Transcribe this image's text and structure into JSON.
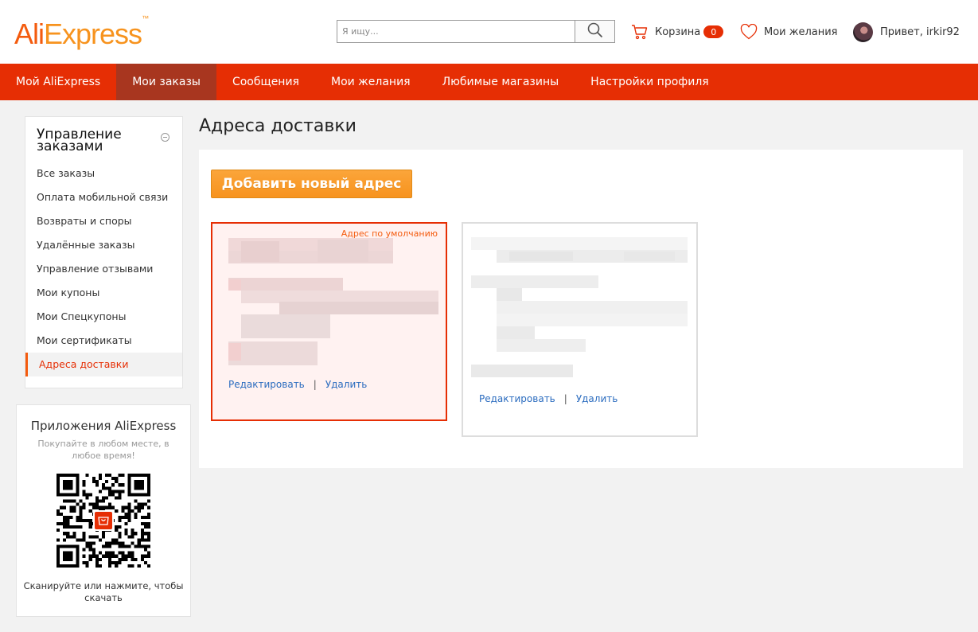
{
  "header": {
    "logo": {
      "ali": "Ali",
      "express": "Express",
      "tm": "™"
    },
    "search": {
      "placeholder": "Я ищу...",
      "value": ""
    },
    "cart": {
      "label": "Корзина",
      "count": "0"
    },
    "wishlist": {
      "label": "Мои желания"
    },
    "user": {
      "greeting": "Привет, irkir92"
    }
  },
  "nav": {
    "items": [
      {
        "label": "Мой AliExpress"
      },
      {
        "label": "Мои заказы",
        "active": true
      },
      {
        "label": "Сообщения"
      },
      {
        "label": "Мои желания"
      },
      {
        "label": "Любимые магазины"
      },
      {
        "label": "Настройки профиля"
      }
    ]
  },
  "sidebar": {
    "title": "Управление заказами",
    "items": [
      {
        "label": "Все заказы"
      },
      {
        "label": "Оплата мобильной связи"
      },
      {
        "label": "Возвраты и споры"
      },
      {
        "label": "Удалённые заказы"
      },
      {
        "label": "Управление отзывами"
      },
      {
        "label": "Мои купоны"
      },
      {
        "label": "Мои Спецкупоны"
      },
      {
        "label": "Мои сертификаты"
      },
      {
        "label": "Адреса доставки",
        "active": true
      }
    ]
  },
  "apps": {
    "title": "Приложения AliExpress",
    "subtitle": "Покупайте в любом месте, в любое время!",
    "scan": "Сканируйте или нажмите, чтобы скачать"
  },
  "main": {
    "title": "Адреса доставки",
    "add_button": "Добавить новый адрес",
    "addresses": [
      {
        "default_label": "Адрес по умолчанию",
        "edit": "Редактировать",
        "separator": "|",
        "delete": "Удалить"
      },
      {
        "edit": "Редактировать",
        "separator": "|",
        "delete": "Удалить"
      }
    ]
  },
  "colors": {
    "accent": "#e62e04",
    "nav_active": "#a8361f",
    "brand_orange": "#f45b0e",
    "button_orange": "#f7931e",
    "link": "#2b6cbf"
  },
  "icons": [
    "search-icon",
    "cart-icon",
    "heart-icon",
    "user-avatar",
    "collapse-icon",
    "qr-code",
    "aliexpress-app-icon"
  ]
}
